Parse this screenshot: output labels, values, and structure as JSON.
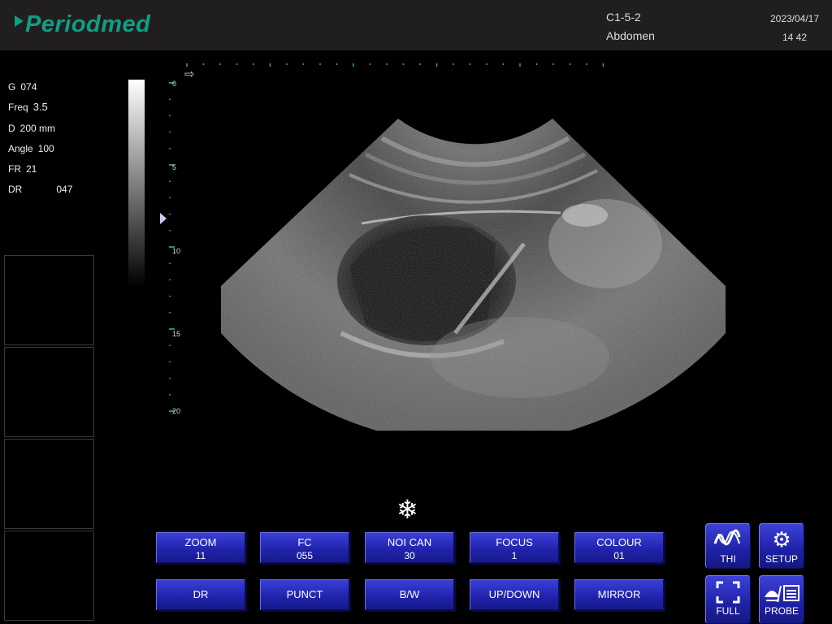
{
  "header": {
    "brand": "Periodmed",
    "probe": "C1-5-2",
    "exam": "Abdomen",
    "date": "2023/04/17",
    "time": "14 42"
  },
  "params": [
    {
      "label": "G",
      "value": "074"
    },
    {
      "label": "Freq",
      "value": "3.5"
    },
    {
      "label": "D",
      "value": "200 mm"
    },
    {
      "label": "Angle",
      "value": "100"
    },
    {
      "label": "FR",
      "value": "21"
    },
    {
      "label": "DR",
      "value": "047"
    }
  ],
  "depth_scale": [
    "0",
    "5",
    "10",
    "15",
    "20"
  ],
  "icons": {
    "freeze": "snowflake-icon",
    "orientation": "arrow-right-icon",
    "focus": "triangle-marker-icon"
  },
  "colors": {
    "brand": "#0f9e86",
    "button": "#2428b8"
  },
  "controls": [
    {
      "name": "zoom",
      "label": "ZOOM",
      "value": "11"
    },
    {
      "name": "fc",
      "label": "FC",
      "value": "055"
    },
    {
      "name": "noi-can",
      "label": "NOI CAN",
      "value": "30"
    },
    {
      "name": "focus",
      "label": "FOCUS",
      "value": "1"
    },
    {
      "name": "colour",
      "label": "COLOUR",
      "value": "01"
    },
    {
      "name": "dr",
      "label": "DR"
    },
    {
      "name": "punct",
      "label": "PUNCT"
    },
    {
      "name": "bw",
      "label": "B/W"
    },
    {
      "name": "updown",
      "label": "UP/DOWN"
    },
    {
      "name": "mirror",
      "label": "MIRROR"
    }
  ],
  "side_buttons": [
    {
      "name": "thi",
      "label": "THI"
    },
    {
      "name": "setup",
      "label": "SETUP"
    },
    {
      "name": "full",
      "label": "FULL"
    },
    {
      "name": "probe",
      "label": "PROBE"
    }
  ]
}
